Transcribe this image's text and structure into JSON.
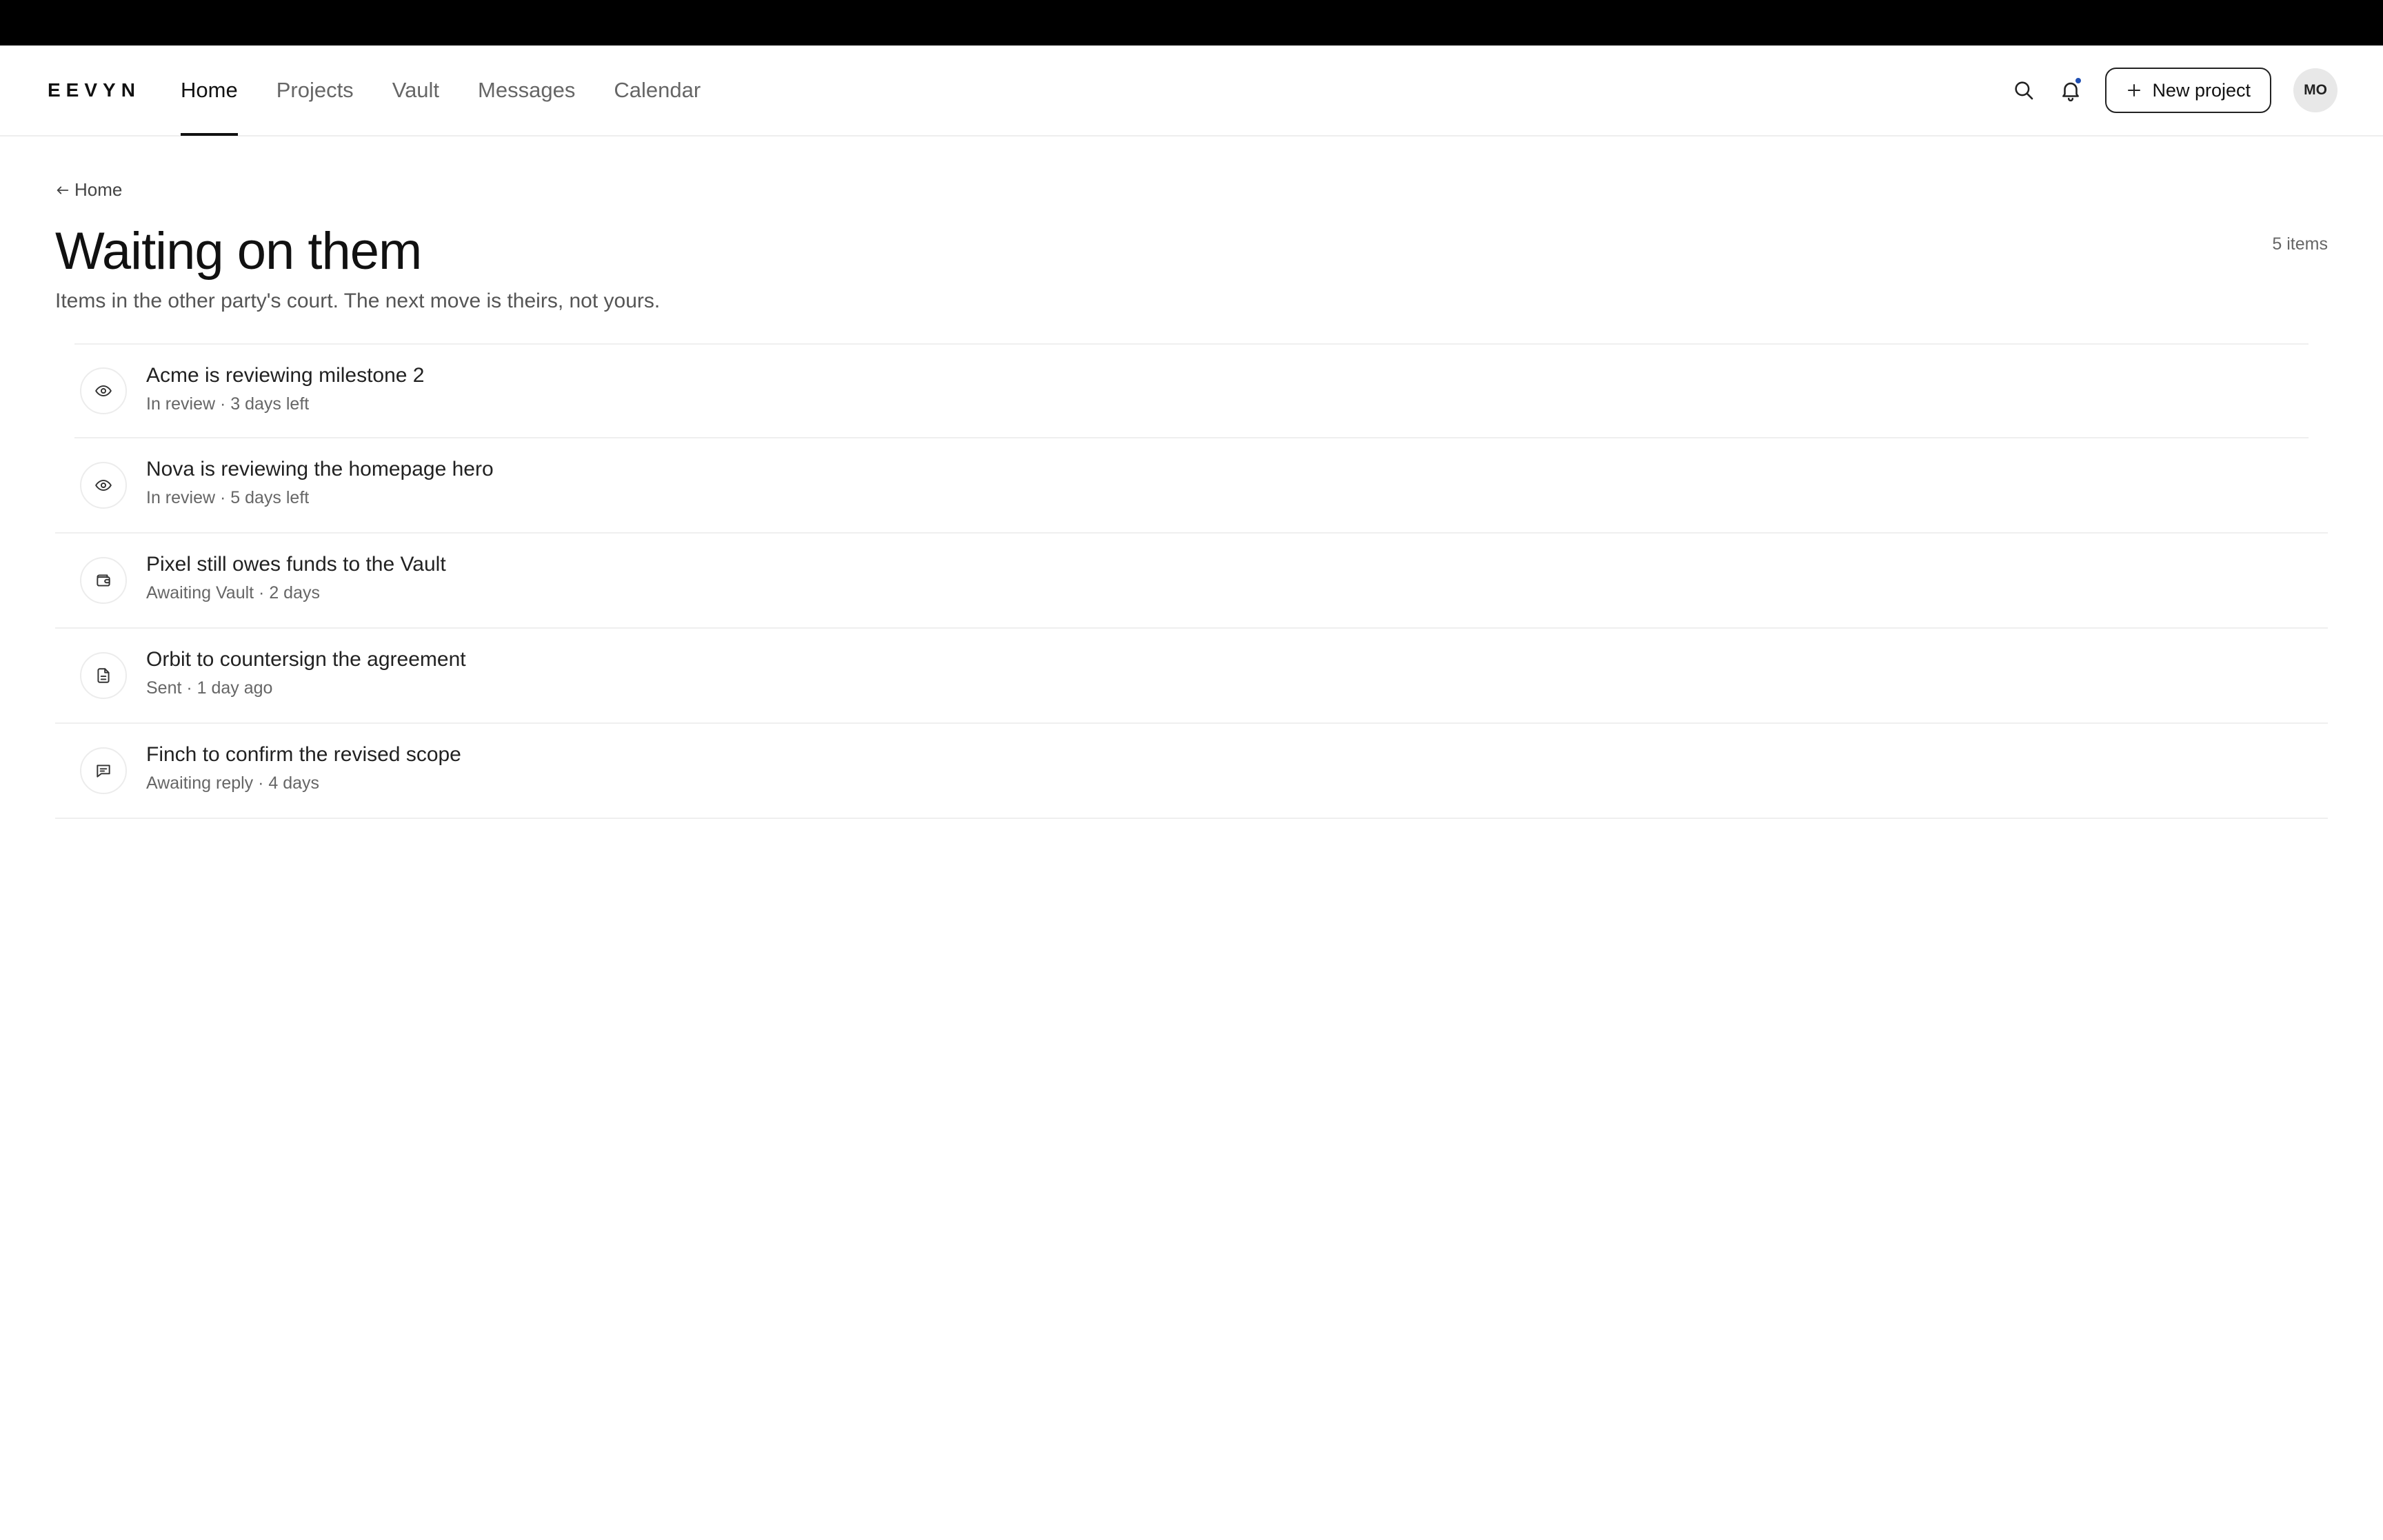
{
  "app": {
    "logo": "EEVYN"
  },
  "nav": {
    "links": [
      {
        "label": "Home",
        "active": true
      },
      {
        "label": "Projects",
        "active": false
      },
      {
        "label": "Vault",
        "active": false
      },
      {
        "label": "Messages",
        "active": false
      },
      {
        "label": "Calendar",
        "active": false
      }
    ],
    "new_project_label": "New project",
    "avatar_initials": "MO",
    "icons": [
      "search-icon",
      "bell-icon",
      "plus-icon"
    ],
    "notification_dot_color": "#1f4fb3"
  },
  "page": {
    "breadcrumb": "Home",
    "title": "Waiting on them",
    "subtitle": "Items in the other party's court. The next move is theirs, not yours.",
    "item_count": "5 items"
  },
  "items": [
    {
      "icon": "eye-icon",
      "title": "Acme is reviewing milestone 2",
      "meta": "In review · 3 days left"
    },
    {
      "icon": "eye-icon",
      "title": "Nova is reviewing the homepage hero",
      "meta": "In review · 5 days left"
    },
    {
      "icon": "wallet-icon",
      "title": "Pixel still owes funds to the Vault",
      "meta": "Awaiting Vault · 2 days"
    },
    {
      "icon": "document-icon",
      "title": "Orbit to countersign the agreement",
      "meta": "Sent · 1 day ago"
    },
    {
      "icon": "message-icon",
      "title": "Finch to confirm the revised scope",
      "meta": "Awaiting reply · 4 days"
    }
  ]
}
